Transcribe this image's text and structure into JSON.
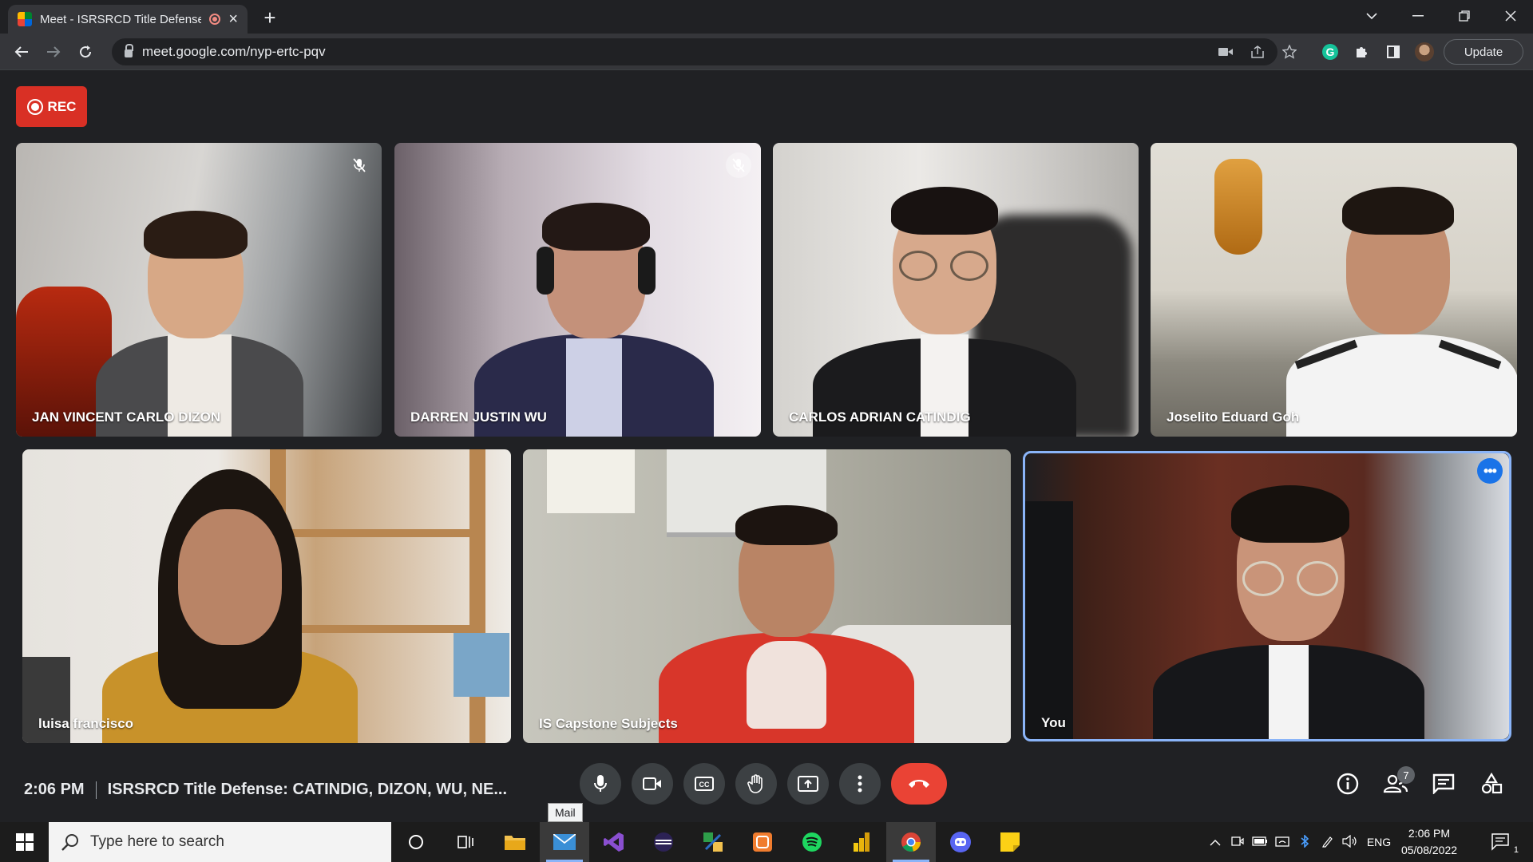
{
  "browser": {
    "tab_title": "Meet - ISRSRCD Title Defense",
    "url": "meet.google.com/nyp-ertc-pqv",
    "update_label": "Update"
  },
  "meet": {
    "rec_label": "REC",
    "participants": [
      {
        "name": "JAN VINCENT CARLO DIZON",
        "muted": true
      },
      {
        "name": "DARREN JUSTIN WU",
        "muted": true
      },
      {
        "name": "CARLOS ADRIAN CATINDIG",
        "muted": false
      },
      {
        "name": "Joselito Eduard Goh",
        "muted": false
      },
      {
        "name": "luisa francisco",
        "muted": false
      },
      {
        "name": "IS Capstone Subjects",
        "muted": false
      },
      {
        "name": "You",
        "muted": false
      }
    ],
    "time": "2:06 PM",
    "meeting_title": "ISRSRCD Title Defense: CATINDIG, DIZON, WU, NE...",
    "people_count": "7",
    "accent_end_call": "#ea4335",
    "accent_self": "#8ab4f8"
  },
  "tooltip": "Mail",
  "taskbar": {
    "search_placeholder": "Type here to search",
    "language": "ENG",
    "time": "2:06 PM",
    "date": "05/08/2022",
    "notifications": "1"
  }
}
